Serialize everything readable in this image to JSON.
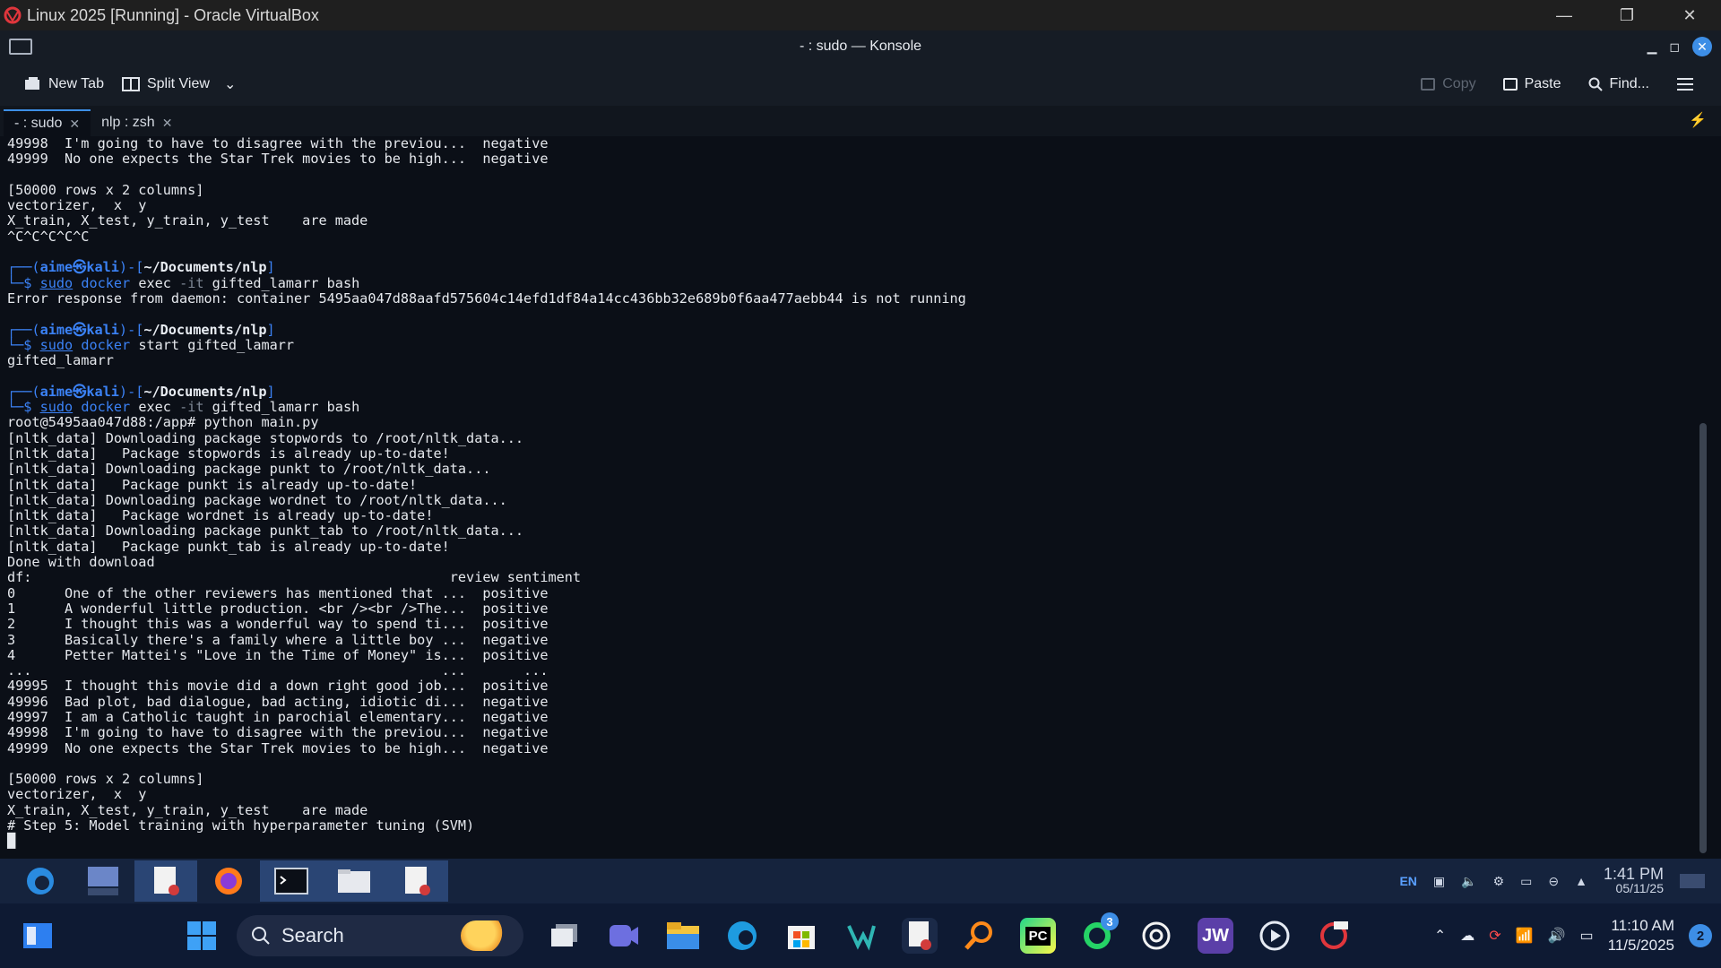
{
  "vbox": {
    "title": "Linux 2025 [Running] - Oracle VirtualBox",
    "controls": [
      "—",
      "❐",
      "✕"
    ]
  },
  "konsole": {
    "title": "- : sudo — Konsole",
    "toolbar": {
      "new_tab": "New Tab",
      "split_view": "Split View",
      "copy": "Copy",
      "paste": "Paste",
      "find": "Find..."
    },
    "tabs": [
      {
        "label": "- : sudo"
      },
      {
        "label": "nlp : zsh"
      }
    ]
  },
  "terminal": {
    "lines": [
      "49998  I'm going to have to disagree with the previou...  negative",
      "49999  No one expects the Star Trek movies to be high...  negative",
      "",
      "[50000 rows x 2 columns]",
      "vectorizer,  x  y",
      "X_train, X_test, y_train, y_test    are made",
      "^C^C^C^C^C",
      "",
      "PROMPT:sudo docker exec -it gifted_lamarr bash",
      "Error response from daemon: container 5495aa047d88aafd575604c14efd1df84a14cc436bb32e689b0f6aa477aebb44 is not running",
      "",
      "PROMPT:sudo docker start gifted_lamarr",
      "gifted_lamarr",
      "",
      "PROMPT:sudo docker exec -it gifted_lamarr bash",
      "root@5495aa047d88:/app# python main.py",
      "[nltk_data] Downloading package stopwords to /root/nltk_data...",
      "[nltk_data]   Package stopwords is already up-to-date!",
      "[nltk_data] Downloading package punkt to /root/nltk_data...",
      "[nltk_data]   Package punkt is already up-to-date!",
      "[nltk_data] Downloading package wordnet to /root/nltk_data...",
      "[nltk_data]   Package wordnet is already up-to-date!",
      "[nltk_data] Downloading package punkt_tab to /root/nltk_data...",
      "[nltk_data]   Package punkt_tab is already up-to-date!",
      "Done with download",
      "df:                                                   review sentiment",
      "0      One of the other reviewers has mentioned that ...  positive",
      "1      A wonderful little production. <br /><br />The...  positive",
      "2      I thought this was a wonderful way to spend ti...  positive",
      "3      Basically there's a family where a little boy ...  negative",
      "4      Petter Mattei's \"Love in the Time of Money\" is...  positive",
      "...                                                  ...       ...",
      "49995  I thought this movie did a down right good job...  positive",
      "49996  Bad plot, bad dialogue, bad acting, idiotic di...  negative",
      "49997  I am a Catholic taught in parochial elementary...  negative",
      "49998  I'm going to have to disagree with the previou...  negative",
      "49999  No one expects the Star Trek movies to be high...  negative",
      "",
      "[50000 rows x 2 columns]",
      "vectorizer,  x  y",
      "X_train, X_test, y_train, y_test    are made",
      "# Step 5: Model training with hyperparameter tuning (SVM)",
      "█"
    ],
    "prompt_user": "aime",
    "prompt_host": "kali",
    "prompt_dir": "~/Documents/nlp"
  },
  "vbox_status": {
    "lang": "EN",
    "time": "1:41 PM",
    "date": "05/11/25"
  },
  "taskbar": {
    "search_label": "Search",
    "time": "11:10 AM",
    "date": "11/5/2025",
    "whatsapp_badge": "3",
    "notification_count": "2",
    "app_labels": {
      "pycharm": "PC",
      "jw": "JW"
    }
  },
  "colors": {
    "accent": "#3d8ee6",
    "terminal_bg": "#0b0f17",
    "prompt": "#3b82f6"
  }
}
